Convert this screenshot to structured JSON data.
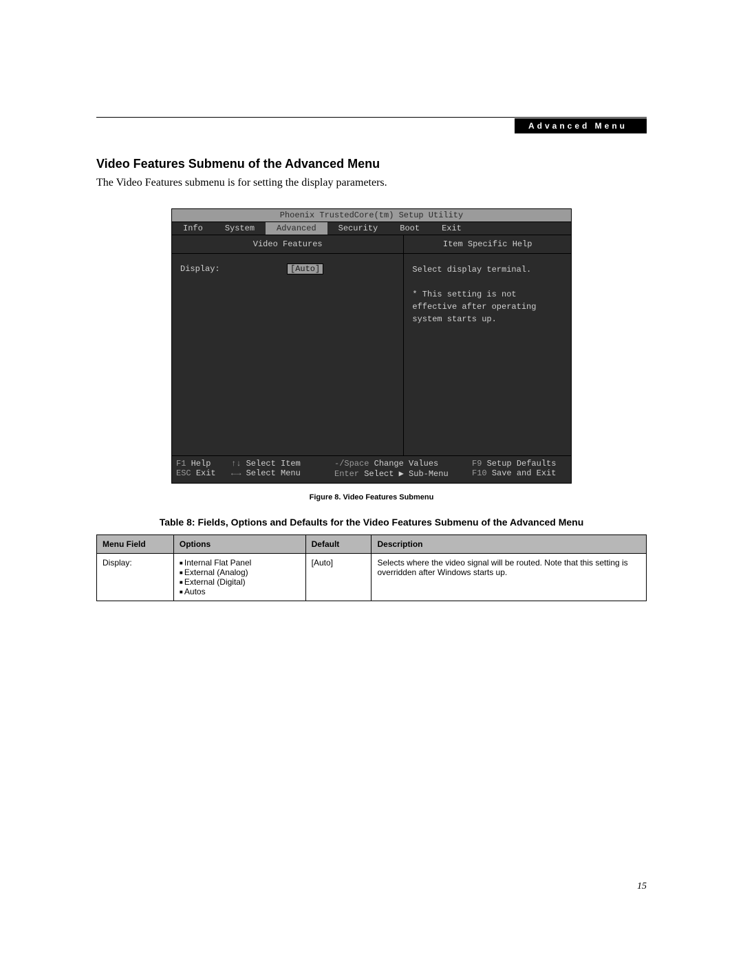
{
  "header": {
    "badge": "Advanced Menu"
  },
  "section": {
    "title": "Video Features Submenu of the Advanced Menu",
    "intro": "The Video Features submenu is for setting the display parameters."
  },
  "bios": {
    "title": "Phoenix TrustedCore(tm) Setup Utility",
    "menus": {
      "items": [
        "Info",
        "System",
        "Advanced",
        "Security",
        "Boot",
        "Exit"
      ],
      "active_index": 2
    },
    "left": {
      "title": "Video Features",
      "display_label": "Display:",
      "display_value": "[Auto]"
    },
    "right": {
      "title": "Item Specific Help",
      "line1": "Select display terminal.",
      "note": "* This setting is not effective after operating system starts up."
    },
    "footer": {
      "r1": {
        "k1": "F1",
        "a1": "Help",
        "k2": "↑↓",
        "a2": "Select Item",
        "k3": "-/Space",
        "a3": "Change Values",
        "k4": "F9",
        "a4": "Setup Defaults"
      },
      "r2": {
        "k1": "ESC",
        "a1": "Exit",
        "k2": "←→",
        "a2": "Select Menu",
        "k3": "Enter",
        "a3": "Select ▶ Sub-Menu",
        "k4": "F10",
        "a4": "Save and Exit"
      }
    }
  },
  "figure_caption": "Figure 8.  Video Features Submenu",
  "table_title": "Table 8: Fields, Options and Defaults for the Video Features Submenu of the Advanced Menu",
  "table": {
    "headers": {
      "c1": "Menu Field",
      "c2": "Options",
      "c3": "Default",
      "c4": "Description"
    },
    "row": {
      "menu_field": "Display:",
      "options": [
        "Internal Flat Panel",
        "External (Analog)",
        "External (Digital)",
        "Autos"
      ],
      "default": "[Auto]",
      "description": "Selects where the video signal will be routed. Note that this setting is overridden after Windows starts up."
    }
  },
  "page_number": "15"
}
